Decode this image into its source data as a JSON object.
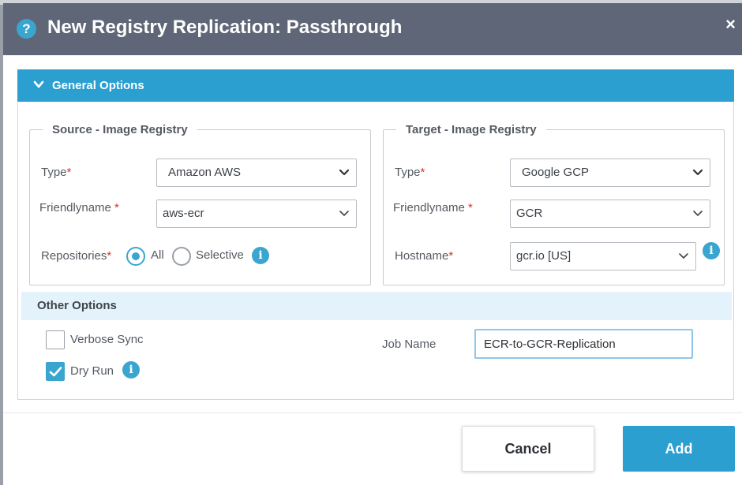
{
  "dialog": {
    "title": "New Registry Replication: Passthrough",
    "help_icon": "question-circle-icon",
    "close_label": "×"
  },
  "general_options": {
    "title": "General Options",
    "source": {
      "legend": "Source - Image Registry",
      "type_label": "Type",
      "type_value": "Amazon AWS",
      "friendlyname_label": "Friendlyname",
      "friendlyname_value": "aws-ecr",
      "repositories_label": "Repositories",
      "repositories_options": [
        "All",
        "Selective"
      ],
      "repositories_selected": "All"
    },
    "target": {
      "legend": "Target - Image Registry",
      "type_label": "Type",
      "type_value": "Google GCP",
      "friendlyname_label": "Friendlyname",
      "friendlyname_value": "GCR",
      "hostname_label": "Hostname",
      "hostname_value": "gcr.io [US]"
    }
  },
  "other_options": {
    "title": "Other Options",
    "verbose_sync": {
      "label": "Verbose Sync",
      "checked": false
    },
    "dry_run": {
      "label": "Dry Run",
      "checked": true
    },
    "job_name_label": "Job Name",
    "job_name_value": "ECR-to-GCR-Replication"
  },
  "footer": {
    "cancel_label": "Cancel",
    "add_label": "Add"
  },
  "colors": {
    "accent": "#2a9fd0",
    "titlebar": "#5f6677",
    "required": "#d9332e",
    "other_bar": "#e4f3fb"
  }
}
